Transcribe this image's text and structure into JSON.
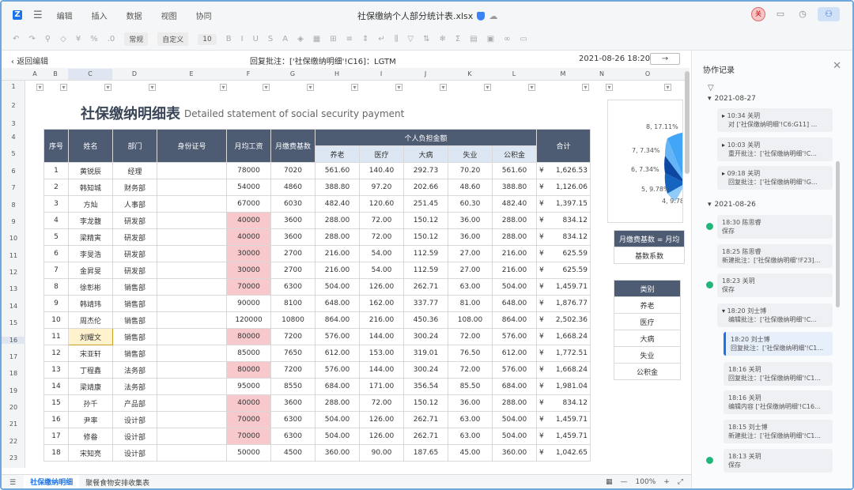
{
  "app": {
    "menu": [
      "编辑",
      "插入",
      "数据",
      "视图",
      "协同"
    ],
    "file_title": "社保缴纳个人部分统计表.xlsx",
    "user_avatar": "关",
    "toolbar": {
      "format": "常规",
      "style": "自定义",
      "font_size": "10"
    }
  },
  "nav": {
    "back_label": "返回编辑",
    "reply_text": "回复批注：['社保缴纳明细'!C16]：LGTM",
    "datetime": "2021-08-26 18:20",
    "next_label": "→"
  },
  "columns": [
    "A",
    "B",
    "C",
    "D",
    "E",
    "F",
    "G",
    "H",
    "I",
    "J",
    "K",
    "L",
    "M",
    "N",
    "O"
  ],
  "rows": [
    "1",
    "2",
    "3",
    "4",
    "5",
    "6",
    "7",
    "8",
    "9",
    "10",
    "11",
    "12",
    "13",
    "14",
    "15",
    "16",
    "17",
    "18",
    "19",
    "20",
    "21",
    "22",
    "23"
  ],
  "sheet": {
    "title": "社保缴纳明细表",
    "subtitle": "Detailed statement of social security payment",
    "headers": {
      "seq": "序号",
      "name": "姓名",
      "dept": "部门",
      "id": "身份证号",
      "salary": "月均工资",
      "base": "月缴费基数",
      "personal": "个人负担金额",
      "total": "合计"
    },
    "sub_headers": [
      "养老",
      "医疗",
      "大病",
      "失业",
      "公积金"
    ],
    "currency": "¥",
    "records": [
      {
        "seq": "1",
        "name": "黄锐辰",
        "dept": "经理",
        "salary": "78000",
        "base": "7020",
        "a": "561.60",
        "b": "140.40",
        "c": "292.73",
        "d": "70.20",
        "e": "561.60",
        "total": "1,626.53"
      },
      {
        "seq": "2",
        "name": "韩知城",
        "dept": "财务部",
        "salary": "54000",
        "base": "4860",
        "a": "388.80",
        "b": "97.20",
        "c": "202.66",
        "d": "48.60",
        "e": "388.80",
        "total": "1,126.06"
      },
      {
        "seq": "3",
        "name": "方灿",
        "dept": "人事部",
        "salary": "67000",
        "base": "6030",
        "a": "482.40",
        "b": "120.60",
        "c": "251.45",
        "d": "60.30",
        "e": "482.40",
        "total": "1,397.15"
      },
      {
        "seq": "4",
        "name": "李龙馥",
        "dept": "研发部",
        "salary": "40000",
        "base": "3600",
        "a": "288.00",
        "b": "72.00",
        "c": "150.12",
        "d": "36.00",
        "e": "288.00",
        "total": "834.12"
      },
      {
        "seq": "5",
        "name": "梁精寅",
        "dept": "研发部",
        "salary": "40000",
        "base": "3600",
        "a": "288.00",
        "b": "72.00",
        "c": "150.12",
        "d": "36.00",
        "e": "288.00",
        "total": "834.12"
      },
      {
        "seq": "6",
        "name": "李旻浩",
        "dept": "研发部",
        "salary": "30000",
        "base": "2700",
        "a": "216.00",
        "b": "54.00",
        "c": "112.59",
        "d": "27.00",
        "e": "216.00",
        "total": "625.59"
      },
      {
        "seq": "7",
        "name": "金昇旻",
        "dept": "研发部",
        "salary": "30000",
        "base": "2700",
        "a": "216.00",
        "b": "54.00",
        "c": "112.59",
        "d": "27.00",
        "e": "216.00",
        "total": "625.59"
      },
      {
        "seq": "8",
        "name": "徐彰彬",
        "dept": "销售部",
        "salary": "70000",
        "base": "6300",
        "a": "504.00",
        "b": "126.00",
        "c": "262.71",
        "d": "63.00",
        "e": "504.00",
        "total": "1,459.71"
      },
      {
        "seq": "9",
        "name": "韩靖玮",
        "dept": "销售部",
        "salary": "90000",
        "base": "8100",
        "a": "648.00",
        "b": "162.00",
        "c": "337.77",
        "d": "81.00",
        "e": "648.00",
        "total": "1,876.77"
      },
      {
        "seq": "10",
        "name": "周杰伦",
        "dept": "销售部",
        "salary": "120000",
        "base": "10800",
        "a": "864.00",
        "b": "216.00",
        "c": "450.36",
        "d": "108.00",
        "e": "864.00",
        "total": "2,502.36"
      },
      {
        "seq": "11",
        "name": "刘耀文",
        "dept": "销售部",
        "salary": "80000",
        "base": "7200",
        "a": "576.00",
        "b": "144.00",
        "c": "300.24",
        "d": "72.00",
        "e": "576.00",
        "total": "1,668.24"
      },
      {
        "seq": "12",
        "name": "宋亚轩",
        "dept": "销售部",
        "salary": "85000",
        "base": "7650",
        "a": "612.00",
        "b": "153.00",
        "c": "319.01",
        "d": "76.50",
        "e": "612.00",
        "total": "1,772.51"
      },
      {
        "seq": "13",
        "name": "丁程鑫",
        "dept": "法务部",
        "salary": "80000",
        "base": "7200",
        "a": "576.00",
        "b": "144.00",
        "c": "300.24",
        "d": "72.00",
        "e": "576.00",
        "total": "1,668.24"
      },
      {
        "seq": "14",
        "name": "梁靖康",
        "dept": "法务部",
        "salary": "95000",
        "base": "8550",
        "a": "684.00",
        "b": "171.00",
        "c": "356.54",
        "d": "85.50",
        "e": "684.00",
        "total": "1,981.04"
      },
      {
        "seq": "15",
        "name": "孙千",
        "dept": "产品部",
        "salary": "40000",
        "base": "3600",
        "a": "288.00",
        "b": "72.00",
        "c": "150.12",
        "d": "36.00",
        "e": "288.00",
        "total": "834.12"
      },
      {
        "seq": "16",
        "name": "尹率",
        "dept": "设计部",
        "salary": "70000",
        "base": "6300",
        "a": "504.00",
        "b": "126.00",
        "c": "262.71",
        "d": "63.00",
        "e": "504.00",
        "total": "1,459.71"
      },
      {
        "seq": "17",
        "name": "修畚",
        "dept": "设计部",
        "salary": "70000",
        "base": "6300",
        "a": "504.00",
        "b": "126.00",
        "c": "262.71",
        "d": "63.00",
        "e": "504.00",
        "total": "1,459.71"
      },
      {
        "seq": "18",
        "name": "宋知亮",
        "dept": "设计部",
        "salary": "50000",
        "base": "4500",
        "a": "360.00",
        "b": "90.00",
        "c": "187.65",
        "d": "45.00",
        "e": "360.00",
        "total": "1,042.65"
      }
    ]
  },
  "pie_labels": [
    "8, 17.11%",
    "7, 7.34%",
    "6, 7.34%",
    "5, 9.78%",
    "4, 9.78"
  ],
  "side_table1": {
    "header": "月缴费基数 = 月均",
    "row": "基数系数"
  },
  "side_table2": {
    "header": "类别",
    "rows": [
      "养老",
      "医疗",
      "大病",
      "失业",
      "公积金"
    ]
  },
  "sheet_tabs": [
    "社保缴纳明细",
    "聚餐食物安排收集表"
  ],
  "zoom": "100%",
  "panel": {
    "title": "协作记录",
    "groups": [
      {
        "date": "2021-08-27",
        "items": [
          {
            "time": "10:34 关玥",
            "text": "对 ['社保缴纳明细'!C6:G11] ..."
          },
          {
            "time": "10:03 关玥",
            "text": "重开批注：['社保缴纳明细'!C..."
          },
          {
            "time": "09:18 关玥",
            "text": "回复批注：['社保缴纳明细'!G..."
          }
        ]
      },
      {
        "date": "2021-08-26",
        "items": [
          {
            "time": "18:30 陈思睿",
            "text": "保存"
          },
          {
            "time": "18:25 陈思睿",
            "text": "新建批注：['社保缴纳明细'!F23]..."
          },
          {
            "time": "18:23 关玥",
            "text": "保存"
          },
          {
            "time": "18:20 刘士博",
            "text": "编辑批注：['社保缴纳明细'!C..."
          },
          {
            "time": "18:20 刘士博",
            "text": "回复批注：['社保缴纳明细'!C1..."
          },
          {
            "time": "18:16 关玥",
            "text": "回复批注：['社保缴纳明细'!C1..."
          },
          {
            "time": "18:16 关玥",
            "text": "编辑内容 ['社保缴纳明细'!C16..."
          },
          {
            "time": "18:15 刘士博",
            "text": "新建批注：['社保缴纳明细'!C1..."
          },
          {
            "time": "18:13 关玥",
            "text": "保存"
          }
        ]
      }
    ]
  },
  "colors": {
    "header_bg": "#4d5b73",
    "pink": "#f8c9cc",
    "accent": "#1a73e8",
    "pie_main": "#1e88e5"
  }
}
